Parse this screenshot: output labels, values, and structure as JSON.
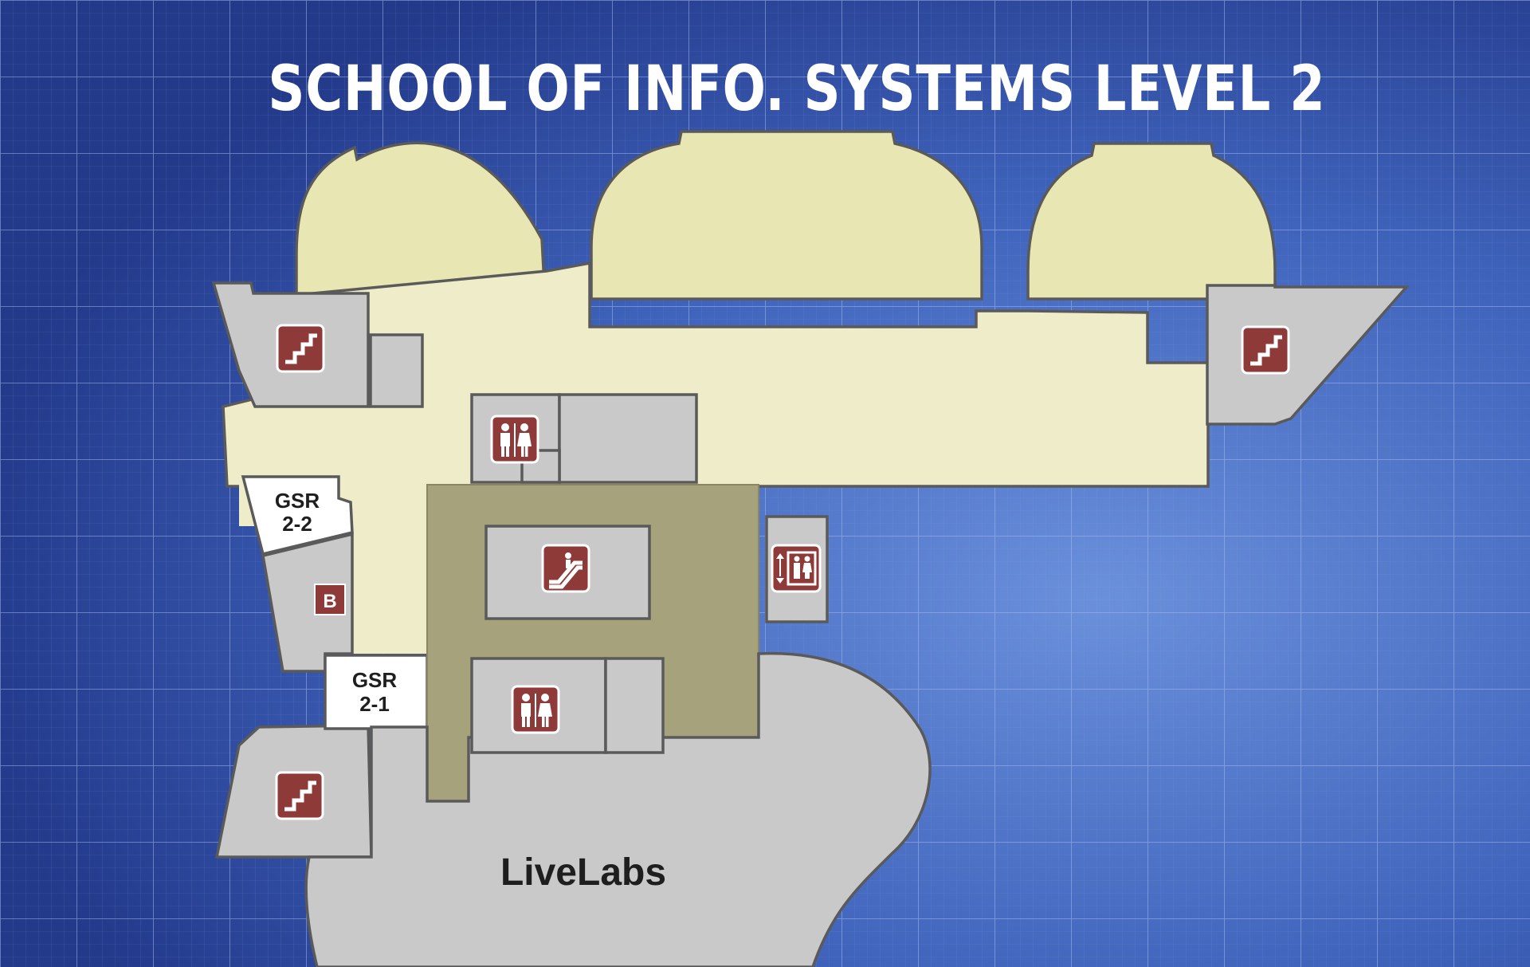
{
  "map": {
    "title": "SCHOOL OF INFO. SYSTEMS LEVEL 2",
    "colors": {
      "background": "#3a5fb8",
      "grid": "#7d9ae0",
      "corridor": "#efecc9",
      "domes": "#e8e6b2",
      "central_block": "#a6a27c",
      "room_gray": "#c9c9c9",
      "room_white": "#ffffff",
      "icon_brown": "#8e3a39",
      "outline": "#5a5a5a"
    },
    "rooms": {
      "gsr_2_2": {
        "line1": "GSR",
        "line2": "2-2"
      },
      "gsr_2_1": {
        "line1": "GSR",
        "line2": "2-1"
      },
      "livelabs": "LiveLabs",
      "b_room": "B"
    },
    "icons": [
      "stairs-icon",
      "restroom-icon",
      "escalator-icon",
      "elevator-icon"
    ]
  }
}
